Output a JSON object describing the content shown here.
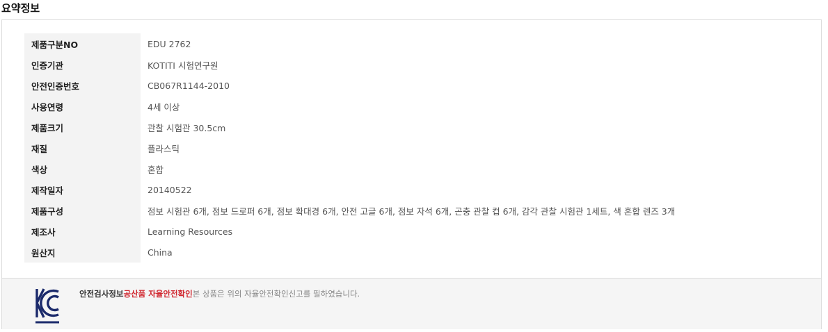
{
  "section_title": "요약정보",
  "specs": [
    {
      "label": "제품구분NO",
      "value": "EDU 2762"
    },
    {
      "label": "인증기관",
      "value": "KOTITI 시험연구원"
    },
    {
      "label": "안전인증번호",
      "value": "CB067R1144-2010"
    },
    {
      "label": "사용연령",
      "value": "4세 이상"
    },
    {
      "label": "제품크기",
      "value": "관찰 시험관 30.5cm"
    },
    {
      "label": "재질",
      "value": "플라스틱"
    },
    {
      "label": "색상",
      "value": "혼합"
    },
    {
      "label": "제작일자",
      "value": "20140522"
    },
    {
      "label": "제품구성",
      "value": "점보 시험관 6개, 점보 드로퍼 6개, 점보 확대경 6개, 안전 고글 6개, 점보 자석 6개, 곤충 관찰 컵 6개, 감각 관찰 시험관 1세트, 색 혼합 렌즈 3개"
    },
    {
      "label": "제조사",
      "value": "Learning Resources"
    },
    {
      "label": "원산지",
      "value": "China"
    }
  ],
  "kc": {
    "logo_icon": "kc-certification-mark",
    "prefix": "안전검사정보",
    "highlight": "공산품 자율안전확인",
    "suffix": "본 상품은 위의 자율안전확인신고를 필하였습니다.",
    "colors": {
      "highlight": "#d0272f",
      "logo": "#1b2a6b"
    }
  }
}
